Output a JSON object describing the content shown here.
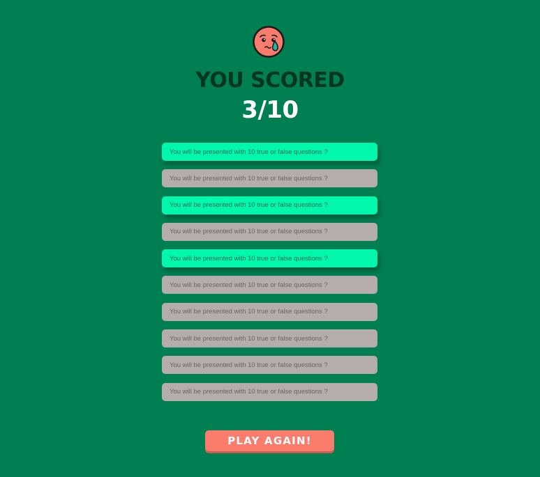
{
  "header": {
    "title": "YOU SCORED",
    "score": "3/10",
    "emoji_icon": "crying-face-icon"
  },
  "results": [
    {
      "text": "You will be presented with 10 true or false questions ?",
      "status": "correct"
    },
    {
      "text": "You will be presented with 10 true or false questions ?",
      "status": "wrong"
    },
    {
      "text": "You will be presented with 10 true or false questions ?",
      "status": "correct"
    },
    {
      "text": "You will be presented with 10 true or false questions ?",
      "status": "wrong"
    },
    {
      "text": "You will be presented with 10 true or false questions ?",
      "status": "correct"
    },
    {
      "text": "You will be presented with 10 true or false questions ?",
      "status": "wrong"
    },
    {
      "text": "You will be presented with 10 true or false questions ?",
      "status": "wrong"
    },
    {
      "text": "You will be presented with 10 true or false questions ?",
      "status": "wrong"
    },
    {
      "text": "You will be presented with 10 true or false questions ?",
      "status": "wrong"
    },
    {
      "text": "You will be presented with 10 true or false questions ?",
      "status": "wrong"
    }
  ],
  "actions": {
    "play_again_label": "PLAY AGAIN!"
  },
  "colors": {
    "background": "#007f52",
    "title": "#05361f",
    "score": "#ffffff",
    "correct": "#00f7ac",
    "wrong": "#b5adac",
    "button": "#fa7c6c",
    "emoji_face": "#fa7c6c",
    "tear": "#1fb8a6"
  }
}
